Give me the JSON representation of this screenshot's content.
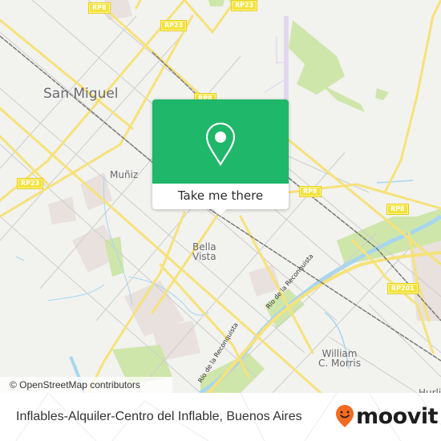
{
  "map": {
    "place_labels": [
      {
        "name": "san-miguel",
        "text": "San Miguel"
      },
      {
        "name": "muniz",
        "text": "Muñiz"
      },
      {
        "name": "bella-vista",
        "line1": "Bella",
        "line2": "Vista"
      },
      {
        "name": "william-c-morris",
        "line1": "William",
        "line2": "C. Morris"
      },
      {
        "name": "hurlingham-partial",
        "text": "Hurli"
      }
    ],
    "road_shields": [
      "RP8",
      "RP23",
      "RP23",
      "RP8",
      "RP23",
      "RP8",
      "RP8",
      "RP201"
    ],
    "river_labels": [
      "Río de la Reconquista",
      "Río de la Reconquista"
    ],
    "attribution": "© OpenStreetMap contributors",
    "colors": {
      "background": "#f2f2ef",
      "major_road": "#f6e27a",
      "minor_road": "#c8c8c8",
      "railway": "#7a7a7a",
      "water": "#a8d6ef",
      "park": "#cde6a8",
      "urban": "#e8e0dc"
    }
  },
  "popup": {
    "icon": "location-pin-icon",
    "button_label": "Take me there",
    "color": "#1fb769"
  },
  "footer": {
    "title": "Inflables-Alquiler-Centro del Inflable, Buenos Aires",
    "brand": "moovit",
    "brand_color": "#f26b21"
  }
}
